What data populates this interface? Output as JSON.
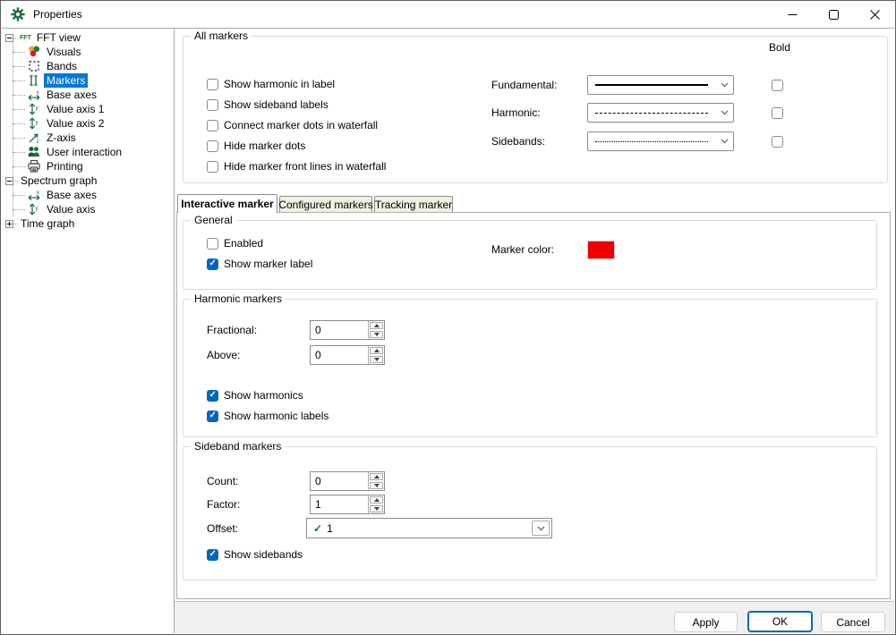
{
  "window": {
    "title": "Properties"
  },
  "tree": {
    "items": [
      {
        "label": "FFT view",
        "selected": false
      },
      {
        "label": "Visuals",
        "selected": false
      },
      {
        "label": "Bands",
        "selected": false
      },
      {
        "label": "Markers",
        "selected": true
      },
      {
        "label": "Base axes",
        "selected": false
      },
      {
        "label": "Value axis 1",
        "selected": false
      },
      {
        "label": "Value axis 2",
        "selected": false
      },
      {
        "label": "Z-axis",
        "selected": false
      },
      {
        "label": "User interaction",
        "selected": false
      },
      {
        "label": "Printing",
        "selected": false
      },
      {
        "label": "Spectrum graph",
        "selected": false
      },
      {
        "label": "Base axes",
        "selected": false
      },
      {
        "label": "Value axis",
        "selected": false
      },
      {
        "label": "Time graph",
        "selected": false
      }
    ]
  },
  "all_markers": {
    "title": "All markers",
    "bold_header": "Bold",
    "checkboxes": [
      {
        "label": "Show harmonic in label",
        "checked": false
      },
      {
        "label": "Show sideband labels",
        "checked": false
      },
      {
        "label": "Connect marker dots in waterfall",
        "checked": false
      },
      {
        "label": "Hide marker dots",
        "checked": false
      },
      {
        "label": "Hide marker front lines in waterfall",
        "checked": false
      }
    ],
    "line_rows": [
      {
        "label": "Fundamental:",
        "style": "solid",
        "bold": false
      },
      {
        "label": "Harmonic:",
        "style": "dashed",
        "bold": false
      },
      {
        "label": "Sidebands:",
        "style": "dotted",
        "bold": false
      }
    ]
  },
  "tabs": [
    {
      "label": "Interactive marker",
      "active": true
    },
    {
      "label": "Configured markers",
      "active": false
    },
    {
      "label": "Tracking marker",
      "active": false
    }
  ],
  "general": {
    "title": "General",
    "checkboxes": [
      {
        "label": "Enabled",
        "checked": false
      },
      {
        "label": "Show marker label",
        "checked": true
      }
    ],
    "marker_color_label": "Marker color:",
    "marker_color": "#ee0000"
  },
  "harmonic": {
    "title": "Harmonic markers",
    "fields": [
      {
        "label": "Fractional:",
        "value": "0"
      },
      {
        "label": "Above:",
        "value": "0"
      }
    ],
    "checkboxes": [
      {
        "label": "Show harmonics",
        "checked": true
      },
      {
        "label": "Show harmonic labels",
        "checked": true
      }
    ]
  },
  "sideband": {
    "title": "Sideband markers",
    "fields": [
      {
        "label": "Count:",
        "value": "0"
      },
      {
        "label": "Factor:",
        "value": "1"
      }
    ],
    "offset": {
      "label": "Offset:",
      "value": "1"
    },
    "checkboxes": [
      {
        "label": "Show sidebands",
        "checked": true
      }
    ]
  },
  "footer": {
    "apply": "Apply",
    "ok": "OK",
    "cancel": "Cancel"
  }
}
